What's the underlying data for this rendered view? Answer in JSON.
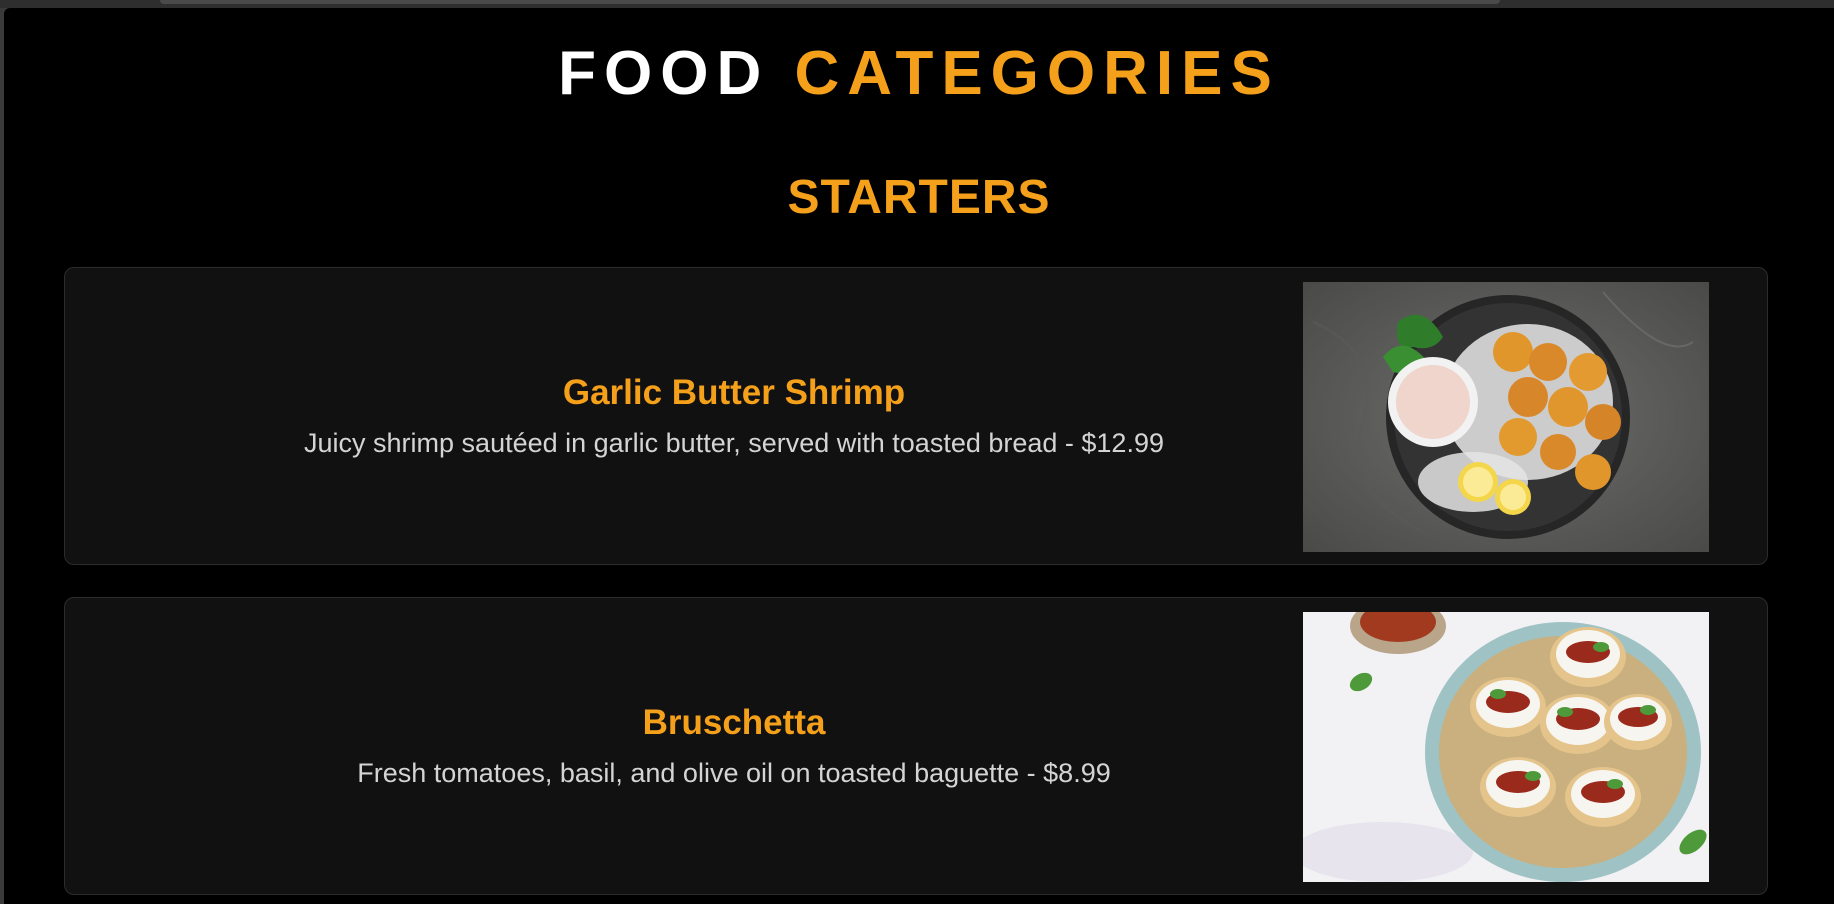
{
  "header": {
    "title_part1": "FOOD",
    "title_part2": "CATEGORIES"
  },
  "section": {
    "title": "STARTERS"
  },
  "items": [
    {
      "name": "Garlic Butter Shrimp",
      "description": "Juicy shrimp sautéed in garlic butter, served with toasted bread - $12.99"
    },
    {
      "name": "Bruschetta",
      "description": "Fresh tomatoes, basil, and olive oil on toasted baguette - $8.99"
    }
  ],
  "colors": {
    "accent": "#f5a01a",
    "background": "#000000",
    "card": "#111111",
    "text": "#d4d4d4"
  }
}
